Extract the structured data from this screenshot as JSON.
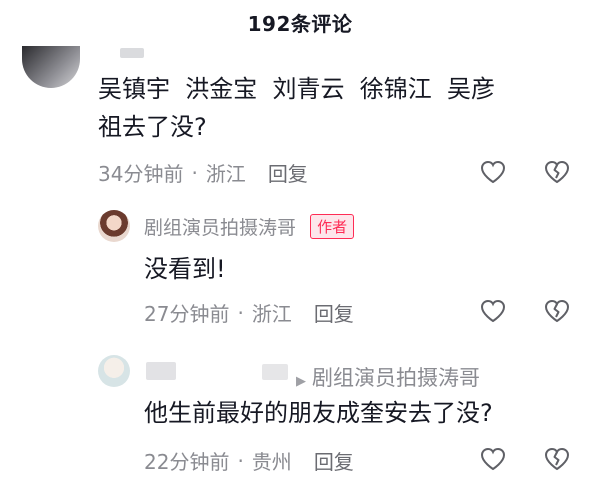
{
  "header": {
    "title": "192条评论"
  },
  "comments": [
    {
      "text_line1": "吴镇宇  洪金宝  刘青云  徐锦江  吴彦",
      "text_line2": "祖去了没?",
      "time": "34分钟前",
      "location": "浙江",
      "reply_label": "回复"
    },
    {
      "author": "剧组演员拍摄涛哥",
      "author_tag": "作者",
      "text": "没看到!",
      "time": "27分钟前",
      "location": "浙江",
      "reply_label": "回复"
    },
    {
      "reply_to": "剧组演员拍摄涛哥",
      "text": "他生前最好的朋友成奎安去了没?",
      "time": "22分钟前",
      "location": "贵州",
      "reply_label": "回复"
    }
  ],
  "meta_separator": "·",
  "icons": {
    "like": "heart-outline-icon",
    "dislike": "broken-heart-icon",
    "reply_arrow": "triangle-right-icon"
  },
  "colors": {
    "text": "#161823",
    "secondary": "#8a8b91",
    "author_tag": "#fe2c55"
  }
}
